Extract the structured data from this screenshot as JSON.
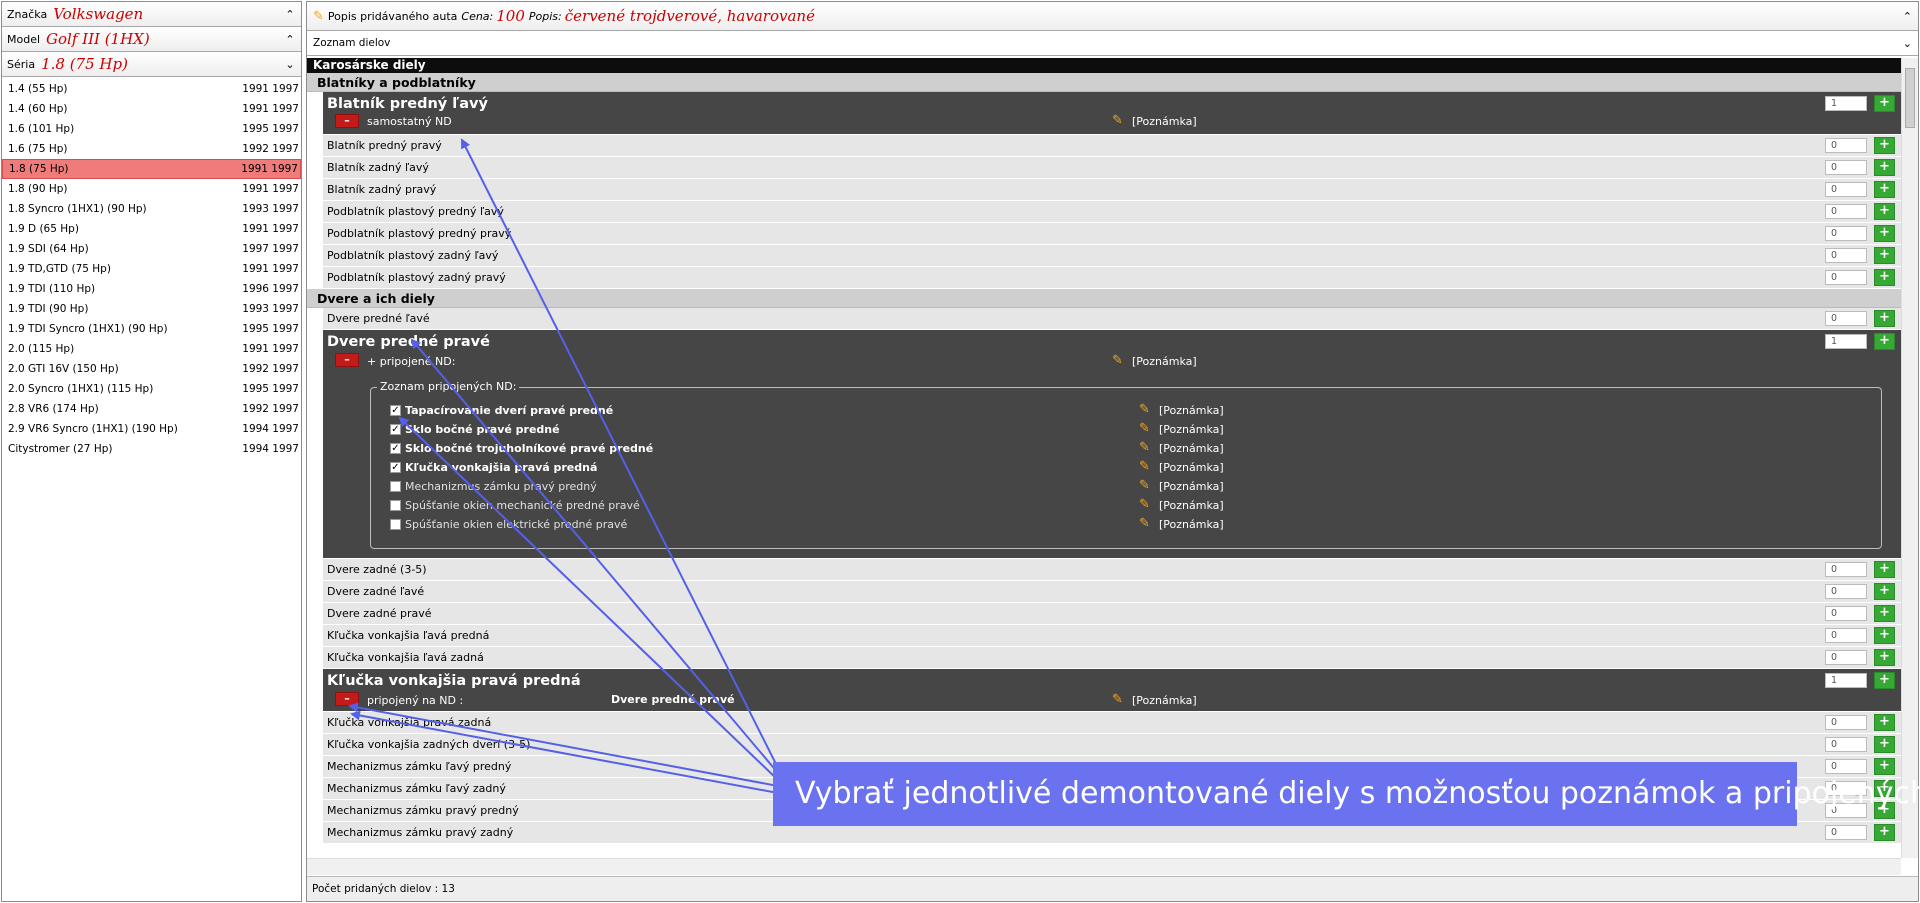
{
  "left_panel": {
    "filters": [
      {
        "label": "Značka",
        "value": "Volkswagen",
        "chevron": "chevron-up-icon"
      },
      {
        "label": "Model",
        "value": "Golf III (1HX)",
        "chevron": "chevron-up-icon"
      },
      {
        "label": "Séria",
        "value": "1.8 (75 Hp)",
        "chevron": "chevron-down-icon"
      }
    ],
    "series": [
      {
        "name": "1.4 (55 Hp)",
        "from": "1991",
        "to": "1997"
      },
      {
        "name": "1.4 (60 Hp)",
        "from": "1991",
        "to": "1997"
      },
      {
        "name": "1.6 (101 Hp)",
        "from": "1995",
        "to": "1997"
      },
      {
        "name": "1.6 (75 Hp)",
        "from": "1992",
        "to": "1997"
      },
      {
        "name": "1.8 (75 Hp)",
        "from": "1991",
        "to": "1997"
      },
      {
        "name": "1.8 (90 Hp)",
        "from": "1991",
        "to": "1997"
      },
      {
        "name": "1.8 Syncro (1HX1) (90 Hp)",
        "from": "1993",
        "to": "1997"
      },
      {
        "name": "1.9 D (65 Hp)",
        "from": "1991",
        "to": "1997"
      },
      {
        "name": "1.9 SDI (64 Hp)",
        "from": "1997",
        "to": "1997"
      },
      {
        "name": "1.9 TD,GTD (75 Hp)",
        "from": "1991",
        "to": "1997"
      },
      {
        "name": "1.9 TDI (110 Hp)",
        "from": "1996",
        "to": "1997"
      },
      {
        "name": "1.9 TDI (90 Hp)",
        "from": "1993",
        "to": "1997"
      },
      {
        "name": "1.9 TDI Syncro (1HX1) (90 Hp)",
        "from": "1995",
        "to": "1997"
      },
      {
        "name": "2.0 (115 Hp)",
        "from": "1991",
        "to": "1997"
      },
      {
        "name": "2.0 GTI 16V (150 Hp)",
        "from": "1992",
        "to": "1997"
      },
      {
        "name": "2.0 Syncro (1HX1) (115 Hp)",
        "from": "1995",
        "to": "1997"
      },
      {
        "name": "2.8 VR6 (174 Hp)",
        "from": "1992",
        "to": "1997"
      },
      {
        "name": "2.9 VR6 Syncro (1HX1) (190 Hp)",
        "from": "1994",
        "to": "1997"
      },
      {
        "name": "Citystromer (27 Hp)",
        "from": "1994",
        "to": "1997"
      }
    ],
    "selected_index": 4
  },
  "header": {
    "title": "Popis pridávaného auta",
    "price_label": "Cena:",
    "price_value": "100",
    "desc_label": "Popis:",
    "desc_value": "červené trojdverové, havarované",
    "parts_list_label": "Zoznam dielov"
  },
  "parts": {
    "category": "Karosárske diely",
    "group1": {
      "title": "Blatníky a podblatníky",
      "expanded": {
        "name": "Blatník predný ľavý",
        "qty": "1",
        "detail": "samostatný ND",
        "note": "[Poznámka]"
      },
      "rows": [
        {
          "name": "Blatník predný pravý",
          "qty": "0"
        },
        {
          "name": "Blatník zadný ľavý",
          "qty": "0"
        },
        {
          "name": "Blatník zadný pravý",
          "qty": "0"
        },
        {
          "name": "Podblatník plastový predný ľavý",
          "qty": "0"
        },
        {
          "name": "Podblatník plastový predný pravý",
          "qty": "0"
        },
        {
          "name": "Podblatník plastový zadný ľavý",
          "qty": "0"
        },
        {
          "name": "Podblatník plastový zadný pravý",
          "qty": "0"
        }
      ]
    },
    "group2": {
      "title": "Dvere a ich diely",
      "row_before": {
        "name": "Dvere predné ľavé",
        "qty": "0"
      },
      "expanded": {
        "name": "Dvere predné pravé",
        "qty": "1",
        "detail": "+ pripojené ND:",
        "note": "[Poznámka]",
        "attached_legend": "Zoznam pripojených ND:",
        "attached": [
          {
            "name": "Tapacírovanie dverí pravé predné",
            "checked": true,
            "note": "[Poznámka]"
          },
          {
            "name": "Sklo bočné pravé predné",
            "checked": true,
            "note": "[Poznámka]"
          },
          {
            "name": "Sklo bočné trojuholníkové pravé predné",
            "checked": true,
            "note": "[Poznámka]"
          },
          {
            "name": "Kľučka vonkajšia pravá predná",
            "checked": true,
            "note": "[Poznámka]"
          },
          {
            "name": "Mechanizmus zámku pravý predný",
            "checked": false,
            "note": "[Poznámka]"
          },
          {
            "name": "Spúšťanie okien mechanické predné pravé",
            "checked": false,
            "note": "[Poznámka]"
          },
          {
            "name": "Spúšťanie okien elektrické predné pravé",
            "checked": false,
            "note": "[Poznámka]"
          }
        ]
      },
      "rows_mid": [
        {
          "name": "Dvere zadné (3-5)",
          "qty": "0"
        },
        {
          "name": "Dvere zadné ľavé",
          "qty": "0"
        },
        {
          "name": "Dvere zadné pravé",
          "qty": "0"
        },
        {
          "name": "Kľučka vonkajšia ľavá predná",
          "qty": "0"
        },
        {
          "name": "Kľučka vonkajšia ľavá zadná",
          "qty": "0"
        }
      ],
      "expanded2": {
        "name": "Kľučka vonkajšia pravá predná",
        "qty": "1",
        "detail": "pripojený na ND :",
        "linked": "Dvere predné pravé",
        "note": "[Poznámka]"
      },
      "rows_after": [
        {
          "name": "Kľučka vonkajšia pravá zadná",
          "qty": "0"
        },
        {
          "name": "Kľučka vonkajšia zadných dverí (3-5)",
          "qty": "0"
        },
        {
          "name": "Mechanizmus zámku ľavý predný",
          "qty": "0"
        },
        {
          "name": "Mechanizmus zámku ľavý zadný",
          "qty": "0"
        },
        {
          "name": "Mechanizmus zámku pravý predný",
          "qty": "0"
        },
        {
          "name": "Mechanizmus zámku pravý zadný",
          "qty": "0"
        }
      ]
    }
  },
  "footer": {
    "added_count": "Počet pridaných dielov : 13"
  },
  "callout": {
    "text": "Vybrať jednotlivé demontované diely s možnosťou poznámok a pripojených ND"
  },
  "icons": {
    "plus": "+",
    "minus": "–",
    "pencil": "pencil-icon",
    "check": "✓"
  },
  "colors": {
    "accent_red": "#cc0000",
    "selected_row": "#ef7b7b",
    "add_green": "#36a935",
    "remove_red": "#c41a1a",
    "callout": "#6a72f0",
    "expanded_bg": "#464646"
  }
}
